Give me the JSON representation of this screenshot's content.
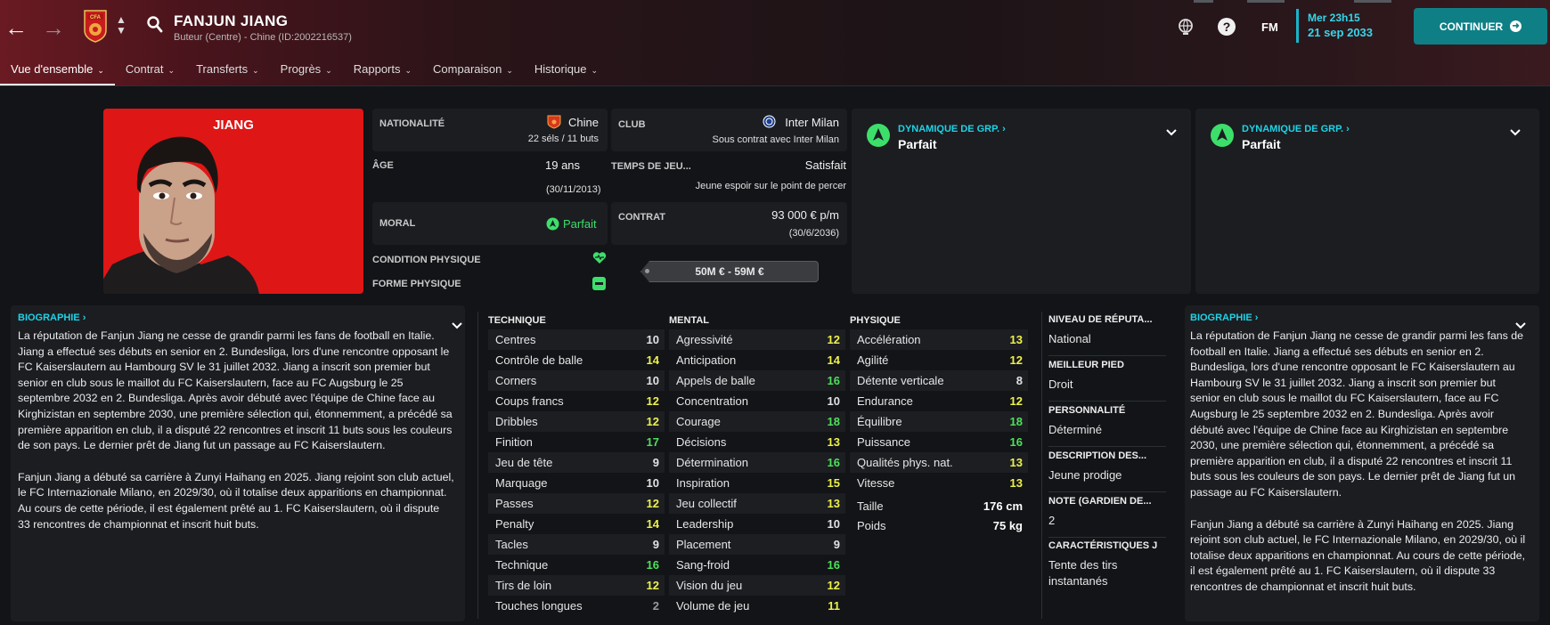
{
  "header": {
    "player_name": "FANJUN JIANG",
    "subtitle": "Buteur (Centre) - Chine (ID:2002216537)",
    "fm_label": "FM",
    "time": "Mer 23h15",
    "date": "21 sep 2033",
    "continue_label": "CONTINUER"
  },
  "tabs": [
    {
      "label": "Vue d'ensemble"
    },
    {
      "label": "Contrat"
    },
    {
      "label": "Transferts"
    },
    {
      "label": "Progrès"
    },
    {
      "label": "Rapports"
    },
    {
      "label": "Comparaison"
    },
    {
      "label": "Historique"
    }
  ],
  "portrait": {
    "name": "JIANG"
  },
  "info": {
    "nationality_label": "NATIONALITÉ",
    "nationality": "Chine",
    "caps": "22 séls / 11 buts",
    "club_label": "CLUB",
    "club": "Inter Milan",
    "contract_status": "Sous contrat avec Inter Milan",
    "age_label": "ÂGE",
    "age": "19 ans",
    "birthdate": "(30/11/2013)",
    "playing_time_label": "TEMPS DE JEU...",
    "playing_time": "Satisfait",
    "playing_time_desc": "Jeune espoir sur le point de percer",
    "morale_label": "MORAL",
    "morale": "Parfait",
    "contract_label": "CONTRAT",
    "wage": "93 000 € p/m",
    "contract_end": "(30/6/2036)",
    "condition_label": "CONDITION PHYSIQUE",
    "form_label": "FORME PHYSIQUE",
    "value": "50M € - 59M €"
  },
  "dynamics": [
    {
      "title": "DYNAMIQUE DE GRP.",
      "value": "Parfait"
    },
    {
      "title": "DYNAMIQUE DE GRP.",
      "value": "Parfait"
    }
  ],
  "bio_title": "BIOGRAPHIE",
  "bio": [
    "La réputation de Fanjun Jiang ne cesse de grandir parmi les fans de football en Italie. Jiang a effectué ses débuts en senior en 2. Bundesliga, lors d'une rencontre opposant le FC Kaiserslautern au Hambourg SV le 31 juillet 2032. Jiang a inscrit son premier but senior en club sous le maillot du FC Kaiserslautern, face au FC Augsburg le 25 septembre 2032 en 2. Bundesliga. Après avoir débuté avec l'équipe de Chine face au Kirghizistan en septembre 2030, une première sélection qui, étonnemment, a précédé sa première apparition en club, il a disputé 22 rencontres et inscrit 11 buts sous les couleurs de son pays. Le dernier prêt de Jiang fut un passage au FC Kaiserslautern.",
    "Fanjun Jiang a débuté sa carrière à Zunyi Haihang en 2025. Jiang rejoint son club actuel, le FC Internazionale Milano, en 2029/30, où il totalise deux apparitions en championnat. Au cours de cette période, il est également prêté au 1. FC Kaiserslautern, où il dispute 33 rencontres de championnat et inscrit huit buts."
  ],
  "attributes": {
    "technique": {
      "title": "TECHNIQUE",
      "rows": [
        {
          "name": "Centres",
          "value": "10",
          "color": "#e2e2e2"
        },
        {
          "name": "Contrôle de balle",
          "value": "14",
          "color": "#eef14b"
        },
        {
          "name": "Corners",
          "value": "10",
          "color": "#e2e2e2"
        },
        {
          "name": "Coups francs",
          "value": "12",
          "color": "#eef14b"
        },
        {
          "name": "Dribbles",
          "value": "12",
          "color": "#eef14b"
        },
        {
          "name": "Finition",
          "value": "17",
          "color": "#4ee05a"
        },
        {
          "name": "Jeu de tête",
          "value": "9",
          "color": "#e2e2e2"
        },
        {
          "name": "Marquage",
          "value": "10",
          "color": "#e2e2e2"
        },
        {
          "name": "Passes",
          "value": "12",
          "color": "#eef14b"
        },
        {
          "name": "Penalty",
          "value": "14",
          "color": "#eef14b"
        },
        {
          "name": "Tacles",
          "value": "9",
          "color": "#e2e2e2"
        },
        {
          "name": "Technique",
          "value": "16",
          "color": "#4ee05a"
        },
        {
          "name": "Tirs de loin",
          "value": "12",
          "color": "#eef14b"
        },
        {
          "name": "Touches longues",
          "value": "2",
          "color": "#9a9a9a"
        }
      ]
    },
    "mental": {
      "title": "MENTAL",
      "rows": [
        {
          "name": "Agressivité",
          "value": "12",
          "color": "#eef14b"
        },
        {
          "name": "Anticipation",
          "value": "14",
          "color": "#eef14b"
        },
        {
          "name": "Appels de balle",
          "value": "16",
          "color": "#4ee05a"
        },
        {
          "name": "Concentration",
          "value": "10",
          "color": "#e2e2e2"
        },
        {
          "name": "Courage",
          "value": "18",
          "color": "#4ee05a"
        },
        {
          "name": "Décisions",
          "value": "13",
          "color": "#eef14b"
        },
        {
          "name": "Détermination",
          "value": "16",
          "color": "#4ee05a"
        },
        {
          "name": "Inspiration",
          "value": "15",
          "color": "#eef14b"
        },
        {
          "name": "Jeu collectif",
          "value": "13",
          "color": "#eef14b"
        },
        {
          "name": "Leadership",
          "value": "10",
          "color": "#e2e2e2"
        },
        {
          "name": "Placement",
          "value": "9",
          "color": "#e2e2e2"
        },
        {
          "name": "Sang-froid",
          "value": "16",
          "color": "#4ee05a"
        },
        {
          "name": "Vision du jeu",
          "value": "12",
          "color": "#eef14b"
        },
        {
          "name": "Volume de jeu",
          "value": "11",
          "color": "#eef14b"
        }
      ]
    },
    "physique": {
      "title": "PHYSIQUE",
      "rows": [
        {
          "name": "Accélération",
          "value": "13",
          "color": "#eef14b"
        },
        {
          "name": "Agilité",
          "value": "12",
          "color": "#eef14b"
        },
        {
          "name": "Détente verticale",
          "value": "8",
          "color": "#e2e2e2"
        },
        {
          "name": "Endurance",
          "value": "12",
          "color": "#eef14b"
        },
        {
          "name": "Équilibre",
          "value": "18",
          "color": "#4ee05a"
        },
        {
          "name": "Puissance",
          "value": "16",
          "color": "#4ee05a"
        },
        {
          "name": "Qualités phys. nat.",
          "value": "13",
          "color": "#eef14b"
        },
        {
          "name": "Vitesse",
          "value": "13",
          "color": "#eef14b"
        }
      ],
      "height_label": "Taille",
      "height": "176 cm",
      "weight_label": "Poids",
      "weight": "75 kg"
    }
  },
  "details": [
    {
      "label": "NIVEAU DE RÉPUTA...",
      "value": "National"
    },
    {
      "label": "MEILLEUR PIED",
      "value": "Droit"
    },
    {
      "label": "PERSONNALITÉ",
      "value": "Déterminé"
    },
    {
      "label": "DESCRIPTION DES...",
      "value": "Jeune prodige"
    },
    {
      "label": "NOTE (GARDIEN DE...",
      "value": "2"
    },
    {
      "label": "CARACTÉRISTIQUES J",
      "value": "Tente des tirs instantanés"
    }
  ]
}
